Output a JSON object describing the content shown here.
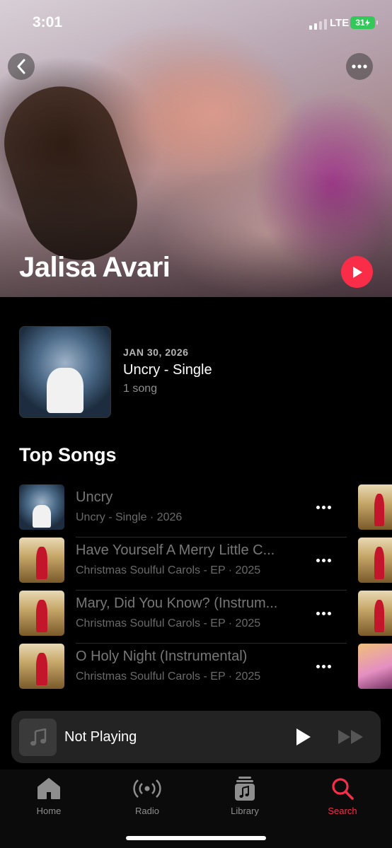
{
  "status_bar": {
    "time": "3:01",
    "network": "LTE",
    "battery": "31"
  },
  "header": {
    "artist_name": "Jalisa Avari"
  },
  "latest_release": {
    "date": "JAN 30, 2026",
    "title": "Uncry - Single",
    "count": "1 song"
  },
  "top_songs": {
    "title": "Top Songs",
    "items": [
      {
        "title": "Uncry",
        "subtitle": "Uncry - Single · 2026"
      },
      {
        "title": "Have Yourself A Merry Little C...",
        "subtitle": "Christmas Soulful Carols - EP · 2025"
      },
      {
        "title": "Mary, Did You Know? (Instrum...",
        "subtitle": "Christmas Soulful Carols - EP · 2025"
      },
      {
        "title": "O Holy Night (Instrumental)",
        "subtitle": "Christmas Soulful Carols - EP · 2025"
      }
    ]
  },
  "mini_player": {
    "title": "Not Playing"
  },
  "tabs": [
    {
      "label": "Home",
      "icon": "house-icon"
    },
    {
      "label": "Radio",
      "icon": "radio-waves-icon"
    },
    {
      "label": "Library",
      "icon": "music-library-icon"
    },
    {
      "label": "Search",
      "icon": "magnifier-icon",
      "active": true
    }
  ],
  "colors": {
    "accent": "#fa2d48",
    "battery": "#34c759"
  }
}
